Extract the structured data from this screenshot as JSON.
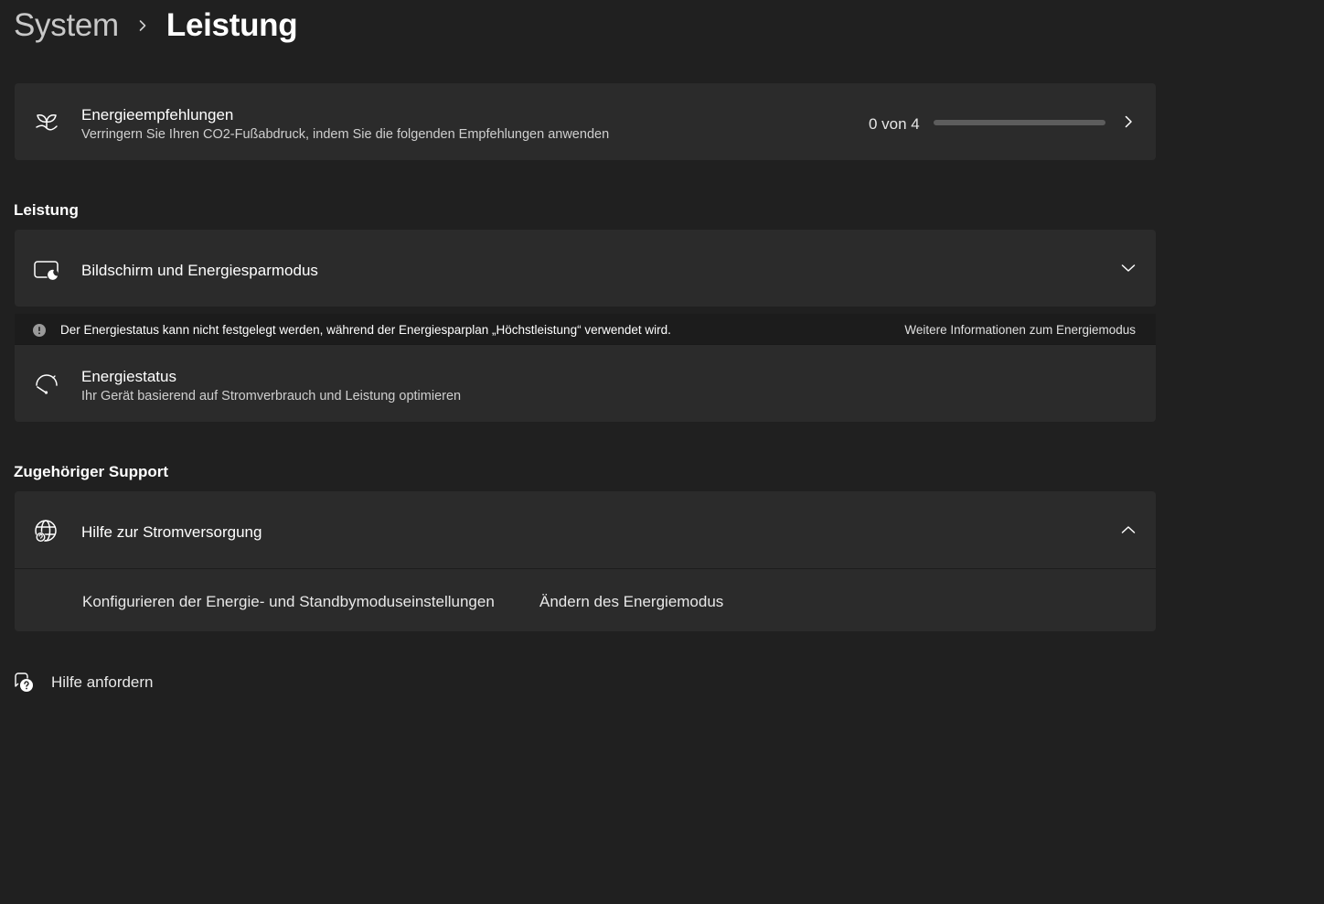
{
  "breadcrumb": {
    "parent": "System",
    "current": "Leistung"
  },
  "energy_recommendations": {
    "title": "Energieempfehlungen",
    "subtitle": "Verringern Sie Ihren CO2-Fußabdruck, indem Sie die folgenden Empfehlungen anwenden",
    "progress_text": "0 von 4",
    "progress_fraction": 0,
    "icon": "leaf-icon",
    "accent_color": "#4cc2ff"
  },
  "performance_section": {
    "header": "Leistung",
    "screen_sleep": {
      "title": "Bildschirm und Energiesparmodus",
      "icon": "screen-sleep-icon"
    },
    "info_bar": {
      "text": "Der Energiestatus kann nicht festgelegt werden, während der Energiesparplan „Höchstleistung“ verwendet wird.",
      "link": "Weitere Informationen zum Energiemodus",
      "icon": "info-icon"
    },
    "power_mode": {
      "title": "Energiestatus",
      "subtitle": "Ihr Gerät basierend auf Stromverbrauch und Leistung optimieren",
      "icon": "gauge-icon"
    }
  },
  "support_section": {
    "header": "Zugehöriger Support",
    "power_help": {
      "title": "Hilfe zur Stromversorgung",
      "icon": "globe-help-icon",
      "links": [
        "Konfigurieren der Energie- und Standbymoduseinstellungen",
        "Ändern des Energiemodus"
      ]
    }
  },
  "get_help": {
    "label": "Hilfe anfordern",
    "icon": "help-chat-icon"
  }
}
